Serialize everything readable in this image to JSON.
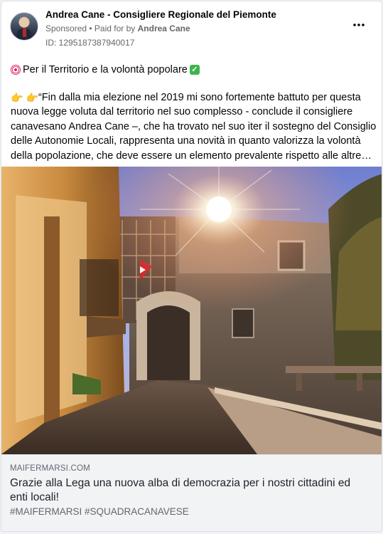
{
  "post": {
    "author": "Andrea Cane - Consigliere Regionale del Piemonte",
    "sponsored_label": "Sponsored",
    "separator": " • ",
    "paid_for_prefix": "Paid for by ",
    "paid_for_name": "Andrea Cane",
    "ad_id": "ID: 1295187387940017",
    "more_icon": "more-horizontal-icon",
    "headline_text": "Per il Territorio e la volontà popolare",
    "body_text": "“Fin dalla mia elezione nel 2019 mi sono fortemente battuto per questa nuova legge voluta dal territorio nel suo complesso - conclude il consigliere canavesano Andrea Cane –, che ha trovato nel suo iter il sostegno del Consiglio delle Autonomie Locali, rappresenta una novità in quanto valorizza la volontà della popolazione, che deve essere un elemento prevalente rispetto alle altre valutazio…",
    "emoji": {
      "target": "direct-hit-emoji",
      "check": "check-mark-emoji",
      "hands": "backhand-index-pointing-right-emoji"
    }
  },
  "link_preview": {
    "domain": "MAIFERMARSI.COM",
    "title": "Grazie alla Lega una nuova alba di democrazia per i nostri cittadini ed enti locali!",
    "hashtags": "#MAIFERMARSI #SQUADRACANAVESE"
  },
  "colors": {
    "text_primary": "#050505",
    "text_secondary": "#65676b",
    "link_box_bg": "#f2f3f5",
    "card_border": "#dddfe2"
  }
}
